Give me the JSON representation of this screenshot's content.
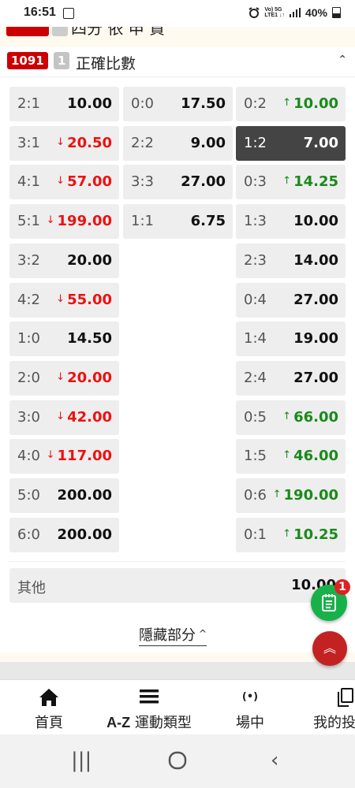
{
  "status_bar": {
    "time": "16:51",
    "network_top": "Vo) 5G",
    "network_bottom": "LTE1 ↓↑",
    "battery": "40%"
  },
  "previous_market": {
    "title": "四分 依 申 貿"
  },
  "market": {
    "code": "1091",
    "count": "1",
    "title": "正確比數"
  },
  "odds": [
    {
      "score": "2:1",
      "odds": "10.00",
      "trend": "",
      "col": 0,
      "row": 0
    },
    {
      "score": "0:0",
      "odds": "17.50",
      "trend": "",
      "col": 1,
      "row": 0
    },
    {
      "score": "0:2",
      "odds": "10.00",
      "trend": "up",
      "col": 2,
      "row": 0
    },
    {
      "score": "3:1",
      "odds": "20.50",
      "trend": "down",
      "col": 0,
      "row": 1
    },
    {
      "score": "2:2",
      "odds": "9.00",
      "trend": "",
      "col": 1,
      "row": 1
    },
    {
      "score": "1:2",
      "odds": "7.00",
      "trend": "",
      "col": 2,
      "row": 1,
      "selected": true
    },
    {
      "score": "4:1",
      "odds": "57.00",
      "trend": "down",
      "col": 0,
      "row": 2
    },
    {
      "score": "3:3",
      "odds": "27.00",
      "trend": "",
      "col": 1,
      "row": 2
    },
    {
      "score": "0:3",
      "odds": "14.25",
      "trend": "up",
      "col": 2,
      "row": 2
    },
    {
      "score": "5:1",
      "odds": "199.00",
      "trend": "down",
      "col": 0,
      "row": 3
    },
    {
      "score": "1:1",
      "odds": "6.75",
      "trend": "",
      "col": 1,
      "row": 3
    },
    {
      "score": "1:3",
      "odds": "10.00",
      "trend": "",
      "col": 2,
      "row": 3
    },
    {
      "score": "3:2",
      "odds": "20.00",
      "trend": "",
      "col": 0,
      "row": 4
    },
    {
      "score": "2:3",
      "odds": "14.00",
      "trend": "",
      "col": 2,
      "row": 4
    },
    {
      "score": "4:2",
      "odds": "55.00",
      "trend": "down",
      "col": 0,
      "row": 5
    },
    {
      "score": "0:4",
      "odds": "27.00",
      "trend": "",
      "col": 2,
      "row": 5
    },
    {
      "score": "1:0",
      "odds": "14.50",
      "trend": "",
      "col": 0,
      "row": 6
    },
    {
      "score": "1:4",
      "odds": "19.00",
      "trend": "",
      "col": 2,
      "row": 6
    },
    {
      "score": "2:0",
      "odds": "20.00",
      "trend": "down",
      "col": 0,
      "row": 7
    },
    {
      "score": "2:4",
      "odds": "27.00",
      "trend": "",
      "col": 2,
      "row": 7
    },
    {
      "score": "3:0",
      "odds": "42.00",
      "trend": "down",
      "col": 0,
      "row": 8
    },
    {
      "score": "0:5",
      "odds": "66.00",
      "trend": "up",
      "col": 2,
      "row": 8
    },
    {
      "score": "4:0",
      "odds": "117.00",
      "trend": "down",
      "col": 0,
      "row": 9
    },
    {
      "score": "1:5",
      "odds": "46.00",
      "trend": "up",
      "col": 2,
      "row": 9
    },
    {
      "score": "5:0",
      "odds": "200.00",
      "trend": "",
      "col": 0,
      "row": 10
    },
    {
      "score": "0:6",
      "odds": "190.00",
      "trend": "up",
      "col": 2,
      "row": 10
    },
    {
      "score": "6:0",
      "odds": "200.00",
      "trend": "",
      "col": 0,
      "row": 11
    },
    {
      "score": "0:1",
      "odds": "10.25",
      "trend": "up",
      "col": 2,
      "row": 11
    }
  ],
  "other": {
    "label": "其他",
    "odds": "10.00"
  },
  "hide_label": "隱藏部分",
  "bet_slip": {
    "count": "1"
  },
  "nav": {
    "home": "首頁",
    "az_prefix": "A-Z",
    "az_label": "運動類型",
    "live": "場中",
    "my_bets": "我的投注"
  },
  "colors": {
    "up": "#1a8a1a",
    "down": "#e11111",
    "brand_red": "#c00000",
    "bet_fab": "#17b14a"
  }
}
